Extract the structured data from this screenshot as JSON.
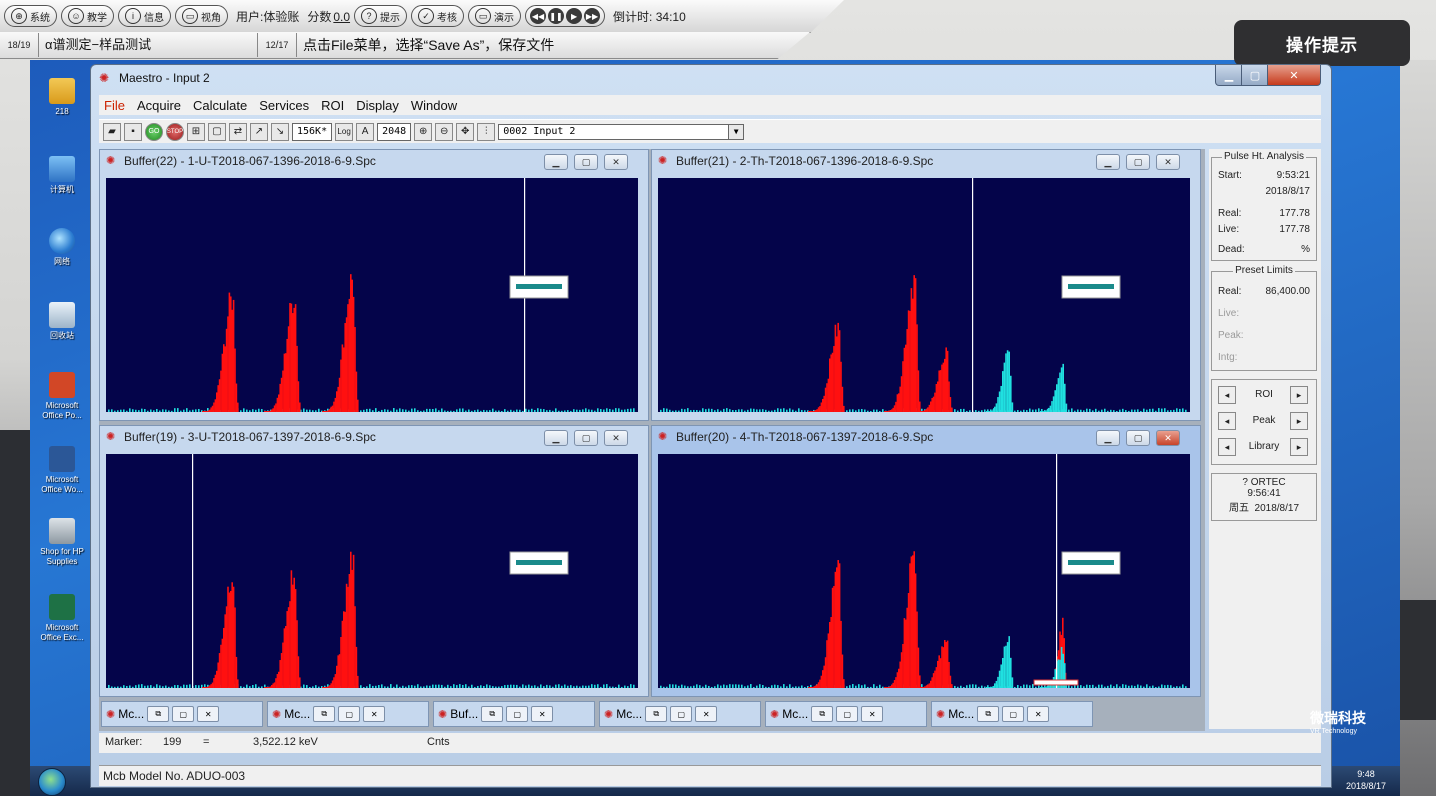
{
  "vr_toolbar": {
    "buttons": [
      {
        "label": "系统",
        "icon": "globe-icon"
      },
      {
        "label": "教学",
        "icon": "teacher-icon"
      },
      {
        "label": "信息",
        "icon": "info-icon"
      },
      {
        "label": "视角",
        "icon": "view-icon"
      }
    ],
    "user_label": "用户:体验账",
    "score_label": "分数",
    "score_value": "0.0",
    "hint_button": "提示",
    "exam_button": "考核",
    "demo_button": "演示",
    "countdown": "倒计时: 34:10"
  },
  "task": {
    "step_num": "18",
    "step_total": "19",
    "step_name": "α谱测定−样品测试",
    "sub_num": "12",
    "sub_total": "17",
    "instruction": "点击File菜单，选择“Save As”，保存文件"
  },
  "hint_panel": {
    "label": "操作提示"
  },
  "desktop_icons": [
    {
      "label": "218",
      "icon": "folder-icon"
    },
    {
      "label": "计算机",
      "icon": "computer-icon"
    },
    {
      "label": "网络",
      "icon": "network-icon"
    },
    {
      "label": "回收站",
      "icon": "recycle-bin-icon"
    },
    {
      "label": "Microsoft Office Po...",
      "icon": "powerpoint-icon"
    },
    {
      "label": "Microsoft Office Wo...",
      "icon": "word-icon"
    },
    {
      "label": "Shop for HP Supplies",
      "icon": "printer-icon"
    },
    {
      "label": "Microsoft Office Exc...",
      "icon": "excel-icon"
    }
  ],
  "taskbar": {
    "time": "9:48",
    "date": "2018/8/17"
  },
  "maestro": {
    "title": "Maestro - Input 2",
    "menu": [
      "File",
      "Acquire",
      "Calculate",
      "Services",
      "ROI",
      "Display",
      "Window"
    ],
    "toolbar": {
      "mem": "156K*",
      "log": "Log",
      "a": "A",
      "channels": "2048",
      "detector": "0002  Input 2",
      "go": "GO",
      "stop": "STOP"
    },
    "buffers": [
      {
        "title": "Buffer(22) - 1-U-T2018-067-1396-2018-6-9.Spc",
        "active": false
      },
      {
        "title": "Buffer(21) - 2-Th-T2018-067-1396-2018-6-9.Spc",
        "active": false
      },
      {
        "title": "Buffer(19) - 3-U-T2018-067-1397-2018-6-9.Spc",
        "active": false
      },
      {
        "title": "Buffer(20) - 4-Th-T2018-067-1397-2018-6-9.Spc",
        "active": true
      }
    ],
    "minimized": [
      "Mc...",
      "Mc...",
      "Buf...",
      "Mc...",
      "Mc...",
      "Mc..."
    ],
    "marker": {
      "label": "Marker:",
      "channel": "199",
      "eq": "=",
      "energy": "3,522.12 keV",
      "cnts": "Cnts"
    },
    "status": "Mcb Model No. ADUO-003",
    "side": {
      "pha_title": "Pulse Ht. Analysis",
      "start_label": "Start:",
      "start_time": "9:53:21",
      "start_date": "2018/8/17",
      "real_label": "Real:",
      "real_value": "177.78",
      "live_label": "Live:",
      "live_value": "177.78",
      "dead_label": "Dead:",
      "dead_unit": "%",
      "preset_title": "Preset Limits",
      "preset_real_label": "Real:",
      "preset_real_value": "86,400.00",
      "preset_live": "Live:",
      "preset_peak": "Peak:",
      "preset_intg": "Intg:",
      "roi": "ROI",
      "peak": "Peak",
      "library": "Library",
      "ortec": "? ORTEC",
      "clock_time": "9:56:41",
      "weekday": "周五",
      "clock_date": "2018/8/17"
    }
  },
  "brand": {
    "name": "微瑞科技",
    "sub": "VR Technology"
  },
  "colors": {
    "plot_bg": "#04044a",
    "peak": "#ff1010",
    "baseline": "#20e0e0",
    "marker": "#ffffff"
  }
}
